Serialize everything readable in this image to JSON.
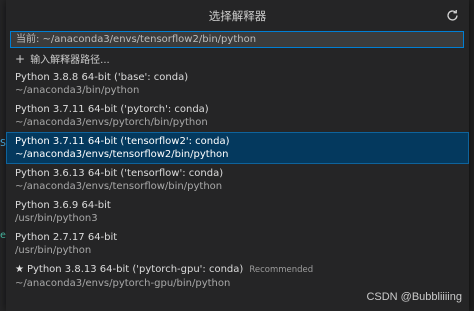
{
  "picker": {
    "title": "选择解释器",
    "refresh_icon": "refresh-icon",
    "input_value": "当前: ~/anaconda3/envs/tensorflow2/bin/python",
    "enter_path_icon": "plus-icon",
    "enter_path_label": "输入解释器路径...",
    "items": [
      {
        "name": "Python 3.8.8 64-bit ('base': conda)",
        "path": "~/anaconda3/bin/python",
        "selected": false,
        "recommended": false,
        "badge": ""
      },
      {
        "name": "Python 3.7.11 64-bit ('pytorch': conda)",
        "path": "~/anaconda3/envs/pytorch/bin/python",
        "selected": false,
        "recommended": false,
        "badge": ""
      },
      {
        "name": "Python 3.7.11 64-bit ('tensorflow2': conda)",
        "path": "~/anaconda3/envs/tensorflow2/bin/python",
        "selected": true,
        "recommended": false,
        "badge": ""
      },
      {
        "name": "Python 3.6.13 64-bit ('tensorflow': conda)",
        "path": "~/anaconda3/envs/tensorflow/bin/python",
        "selected": false,
        "recommended": false,
        "badge": ""
      },
      {
        "name": "Python 3.6.9 64-bit",
        "path": "/usr/bin/python3",
        "selected": false,
        "recommended": false,
        "badge": ""
      },
      {
        "name": "Python 2.7.17 64-bit",
        "path": "/usr/bin/python",
        "selected": false,
        "recommended": false,
        "badge": ""
      },
      {
        "name": "Python 3.8.13 64-bit ('pytorch-gpu': conda)",
        "path": "~/anaconda3/envs/pytorch-gpu/bin/python",
        "selected": false,
        "recommended": true,
        "badge": "Recommended"
      }
    ]
  },
  "edge": {
    "glyph_s": "S",
    "glyph_e": "e",
    "color_s": "#4fc1ff",
    "color_e": "#4ec9b0"
  },
  "watermark": "CSDN @Bubbliiiing",
  "colors": {
    "accent": "#007fd4",
    "selection_bg": "#04395e",
    "panel_bg": "#252526"
  }
}
